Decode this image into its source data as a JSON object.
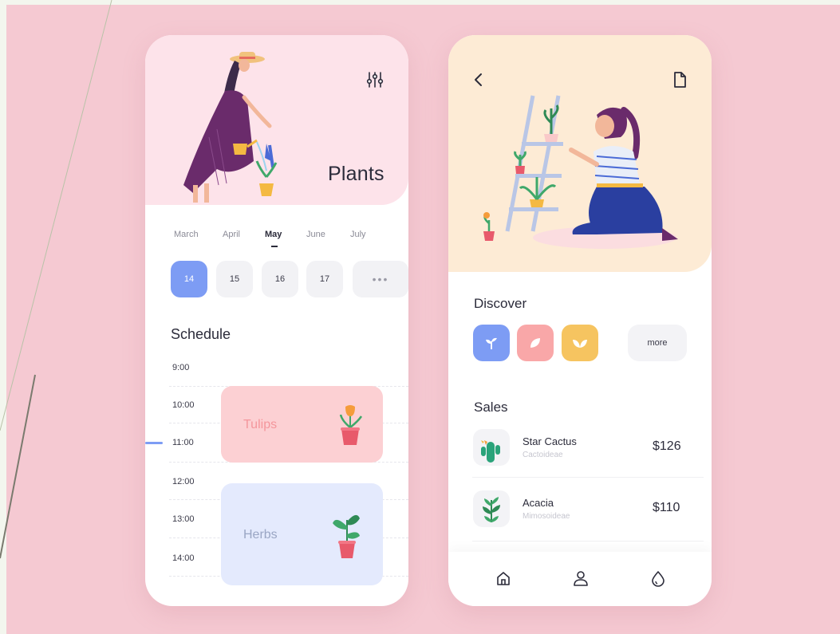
{
  "left_screen": {
    "title": "Plants",
    "icons": {
      "filter": "sliders-icon"
    },
    "months": [
      {
        "label": "March",
        "active": false
      },
      {
        "label": "April",
        "active": false
      },
      {
        "label": "May",
        "active": true
      },
      {
        "label": "June",
        "active": false
      },
      {
        "label": "July",
        "active": false
      }
    ],
    "days": [
      {
        "label": "14",
        "active": true
      },
      {
        "label": "15",
        "active": false
      },
      {
        "label": "16",
        "active": false
      },
      {
        "label": "17",
        "active": false
      }
    ],
    "days_more": "•••",
    "schedule_title": "Schedule",
    "times": [
      "9:00",
      "10:00",
      "11:00",
      "12:00",
      "13:00",
      "14:00"
    ],
    "events": [
      {
        "label": "Tulips",
        "color": "#fcd0d3",
        "text_color": "#f4969c"
      },
      {
        "label": "Herbs",
        "color": "#e4eafd",
        "text_color": "#9aa6c4"
      }
    ]
  },
  "right_screen": {
    "icons": {
      "back": "chevron-left-icon",
      "document": "document-icon"
    },
    "discover_title": "Discover",
    "categories": [
      {
        "icon": "sprout-icon",
        "color": "#7d9cf4"
      },
      {
        "icon": "leaf-icon",
        "color": "#f9a7a8"
      },
      {
        "icon": "double-leaf-icon",
        "color": "#f6c460"
      }
    ],
    "more_label": "more",
    "sales_title": "Sales",
    "sales": [
      {
        "name": "Star Cactus",
        "subtitle": "Cactoideae",
        "price": "$126"
      },
      {
        "name": "Acacia",
        "subtitle": "Mimosoideae",
        "price": "$110"
      }
    ],
    "bottom_nav": [
      "home-icon",
      "user-icon",
      "drop-icon"
    ]
  },
  "colors": {
    "background": "#f5c9d2",
    "accent_blue": "#7d9cf4",
    "hero_pink": "#fde3ea",
    "hero_peach": "#fdebd5"
  }
}
